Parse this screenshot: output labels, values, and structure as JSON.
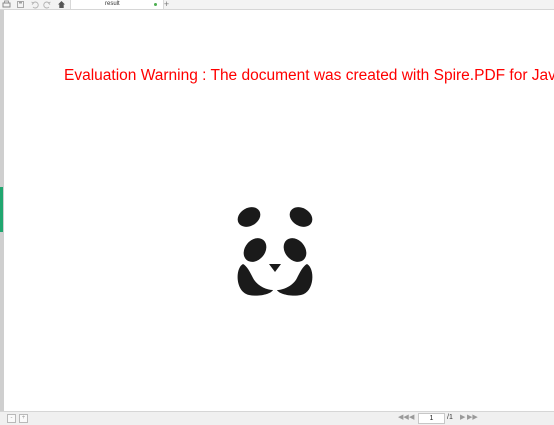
{
  "tab": {
    "title": "result",
    "add_label": "+"
  },
  "toolbar": {
    "icons": [
      "print-icon",
      "save-icon",
      "undo-icon",
      "redo-icon",
      "home-icon"
    ]
  },
  "document": {
    "warning_text": "Evaluation Warning : The document was created with Spire.PDF for Java.",
    "warning_color": "#ff0000"
  },
  "statusbar": {
    "current_page": "1",
    "page_total": "/1"
  },
  "colors": {
    "accent_green": "#20a66f",
    "tab_dot": "#4caf50"
  }
}
